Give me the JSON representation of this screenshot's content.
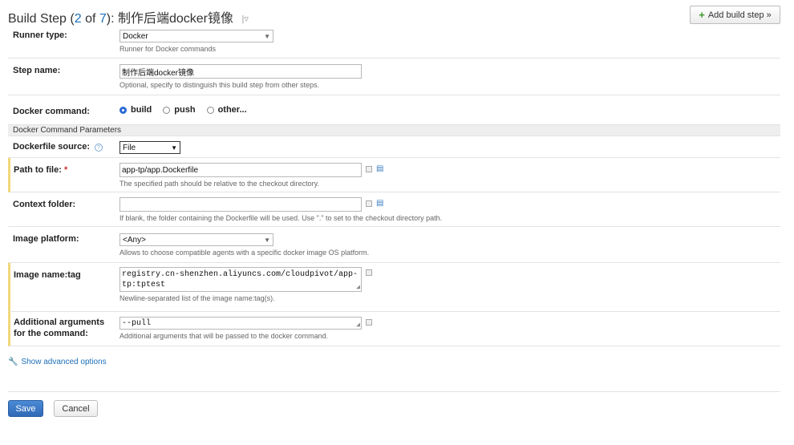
{
  "header": {
    "prefix": "Build Step (",
    "step_current": "2",
    "of_word": " of ",
    "step_total": "7",
    "suffix": "): ",
    "step_name": "制作后端docker镜像",
    "menu_glyph": "|▿"
  },
  "add_step_button": {
    "icon": "+",
    "label": "Add build step »"
  },
  "runner_type": {
    "label": "Runner type:",
    "value": "Docker",
    "note": "Runner for Docker commands"
  },
  "step_name": {
    "label": "Step name:",
    "value": "制作后端docker镜像",
    "note": "Optional, specify to distinguish this build step from other steps."
  },
  "docker_command": {
    "label": "Docker command:",
    "options": [
      "build",
      "push",
      "other..."
    ],
    "selected": "build"
  },
  "section_title": "Docker Command Parameters",
  "dockerfile_source": {
    "label": "Dockerfile source:",
    "help_glyph": "?",
    "value": "File"
  },
  "path_to_file": {
    "label": "Path to file:",
    "required_mark": "*",
    "value": "app-tp/app.Dockerfile",
    "note": "The specified path should be relative to the checkout directory."
  },
  "context_folder": {
    "label": "Context folder:",
    "value": "",
    "note": "If blank, the folder containing the Dockerfile will be used. Use \".\" to set to the checkout directory path."
  },
  "image_platform": {
    "label": "Image platform:",
    "value": "<Any>",
    "note": "Allows to choose compatible agents with a specific docker image OS platform."
  },
  "image_name_tag": {
    "label": "Image name:tag",
    "value_line1": "registry.cn-shenzhen.aliyuncs.com/cloudpivot/app-",
    "value_line2": "tp:tptest",
    "note": "Newline-separated list of the image name:tag(s)."
  },
  "additional_args": {
    "label_line1": "Additional arguments",
    "label_line2": "for the command:",
    "value": "--pull",
    "note": "Additional arguments that will be passed to the docker command."
  },
  "advanced_link": "Show advanced options",
  "buttons": {
    "save": "Save",
    "cancel": "Cancel"
  },
  "colors": {
    "link": "#1d6fb8",
    "save_button": "#2f69b7",
    "required": "#d0302f",
    "mandatory_bar": "#f2d779"
  }
}
